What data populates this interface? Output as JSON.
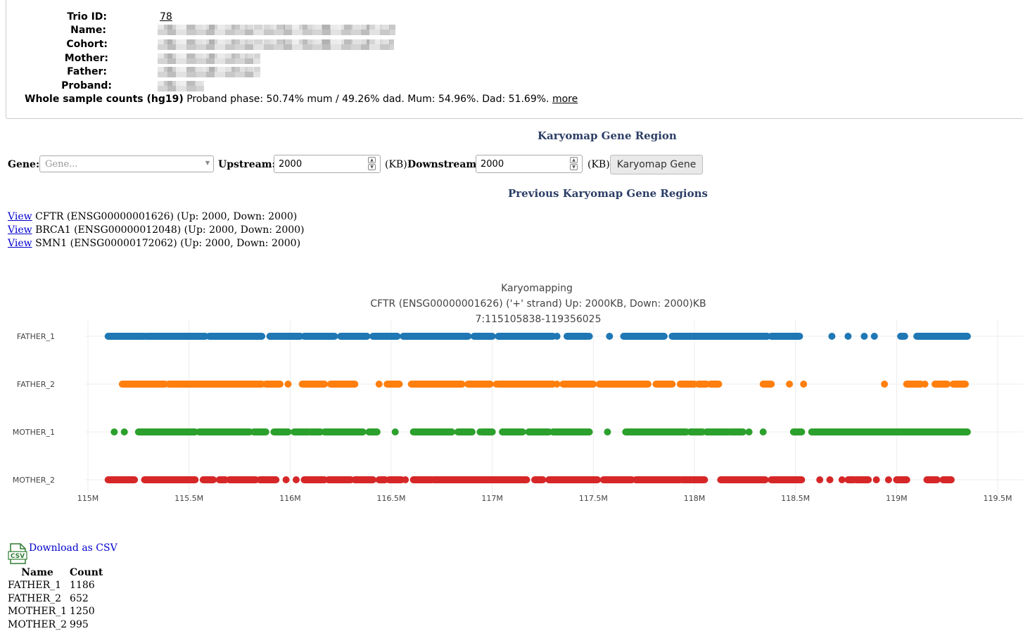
{
  "trio": {
    "labels": {
      "trio_id": "Trio ID:",
      "name": "Name:",
      "cohort": "Cohort:",
      "mother": "Mother:",
      "father": "Father:",
      "proband": "Proband:"
    },
    "trio_id_value": "78",
    "whole_sample_label": "Whole sample counts (hg19)",
    "whole_sample_text": "Proband phase: 50.74% mum / 49.26% dad. Mum: 54.96%. Dad: 51.69%.",
    "more_link": "more"
  },
  "gene_region": {
    "heading": "Karyomap Gene Region",
    "gene_label": "Gene:",
    "gene_placeholder": "Gene...",
    "upstream_label": "Upstream:",
    "upstream_value": "2000",
    "downstream_label": "Downstream:",
    "downstream_value": "2000",
    "unit": "(KB)",
    "button_label": "Karyomap Gene"
  },
  "previous": {
    "heading": "Previous Karyomap Gene Regions",
    "items": [
      {
        "link": "View",
        "text": "CFTR (ENSG00000001626) (Up: 2000, Down: 2000)"
      },
      {
        "link": "View",
        "text": "BRCA1 (ENSG00000012048) (Up: 2000, Down: 2000)"
      },
      {
        "link": "View",
        "text": "SMN1 (ENSG00000172062) (Up: 2000, Down: 2000)"
      }
    ]
  },
  "chart_data": {
    "type": "scatter",
    "title": "Karyomapping",
    "subtitle": "CFTR (ENSG00000001626) ('+' strand) Up: 2000KB, Down: 2000)KB",
    "region": "7:115105838-119356025",
    "xlim": [
      115000000,
      119500000
    ],
    "x_ticks": [
      {
        "value": 115000000,
        "label": "115M"
      },
      {
        "value": 115500000,
        "label": "115.5M"
      },
      {
        "value": 116000000,
        "label": "116M"
      },
      {
        "value": 116500000,
        "label": "116.5M"
      },
      {
        "value": 117000000,
        "label": "117M"
      },
      {
        "value": 117500000,
        "label": "117.5M"
      },
      {
        "value": 118000000,
        "label": "118M"
      },
      {
        "value": 118500000,
        "label": "118.5M"
      },
      {
        "value": 119000000,
        "label": "119M"
      },
      {
        "value": 119500000,
        "label": "119.5M"
      }
    ],
    "grid": true,
    "series": [
      {
        "name": "FATHER_1",
        "color": "#1f77b4",
        "segments": [
          [
            115.1,
            115.28
          ],
          [
            115.29,
            115.58
          ],
          [
            115.6,
            115.86
          ],
          [
            115.9,
            116.05
          ],
          [
            116.07,
            116.22
          ],
          [
            116.25,
            116.38
          ],
          [
            116.41,
            116.53
          ],
          [
            116.56,
            116.88
          ],
          [
            116.91,
            117.0
          ],
          [
            117.03,
            117.3
          ],
          [
            117.37,
            117.47
          ],
          [
            117.65,
            117.85
          ],
          [
            117.89,
            118.36
          ],
          [
            118.38,
            118.52
          ],
          [
            119.02,
            119.04
          ],
          [
            119.1,
            119.35
          ]
        ],
        "points": [
          117.32,
          117.48,
          117.58,
          118.68,
          118.76,
          118.84,
          118.89
        ]
      },
      {
        "name": "FATHER_2",
        "color": "#ff7f0e",
        "segments": [
          [
            115.17,
            115.38
          ],
          [
            115.4,
            115.86
          ],
          [
            115.88,
            115.95
          ],
          [
            116.06,
            116.17
          ],
          [
            116.2,
            116.32
          ],
          [
            116.48,
            116.54
          ],
          [
            116.6,
            116.85
          ],
          [
            116.88,
            116.99
          ],
          [
            117.03,
            117.3
          ],
          [
            117.35,
            117.5
          ],
          [
            117.53,
            117.77
          ],
          [
            117.81,
            117.89
          ],
          [
            117.93,
            118.0
          ],
          [
            118.02,
            118.06
          ],
          [
            118.08,
            118.12
          ],
          [
            118.34,
            118.38
          ],
          [
            119.05,
            119.12
          ],
          [
            119.19,
            119.25
          ],
          [
            119.28,
            119.34
          ]
        ],
        "points": [
          115.99,
          116.44,
          117.02,
          117.32,
          118.47,
          118.54,
          118.94,
          119.14
        ]
      },
      {
        "name": "MOTHER_1",
        "color": "#2ca02c",
        "segments": [
          [
            115.25,
            115.53
          ],
          [
            115.55,
            115.8
          ],
          [
            115.82,
            115.88
          ],
          [
            115.92,
            115.99
          ],
          [
            116.02,
            116.09
          ],
          [
            116.1,
            116.15
          ],
          [
            116.17,
            116.36
          ],
          [
            116.39,
            116.43
          ],
          [
            116.61,
            116.8
          ],
          [
            116.83,
            116.9
          ],
          [
            116.95,
            117.0
          ],
          [
            117.05,
            117.15
          ],
          [
            117.18,
            117.28
          ],
          [
            117.3,
            117.48
          ],
          [
            117.66,
            117.96
          ],
          [
            117.98,
            118.04
          ],
          [
            118.06,
            118.17
          ],
          [
            118.18,
            118.24
          ],
          [
            118.49,
            118.53
          ],
          [
            118.58,
            119.35
          ]
        ],
        "points": [
          115.13,
          115.18,
          116.52,
          116.94,
          117.57,
          118.27,
          118.34
        ]
      },
      {
        "name": "MOTHER_2",
        "color": "#d62728",
        "segments": [
          [
            115.1,
            115.23
          ],
          [
            115.28,
            115.53
          ],
          [
            115.57,
            115.62
          ],
          [
            115.65,
            115.68
          ],
          [
            115.7,
            115.83
          ],
          [
            115.85,
            115.93
          ],
          [
            116.07,
            116.17
          ],
          [
            116.19,
            116.3
          ],
          [
            116.32,
            116.41
          ],
          [
            116.44,
            116.47
          ],
          [
            116.49,
            116.55
          ],
          [
            116.61,
            116.7
          ],
          [
            116.71,
            117.17
          ],
          [
            117.21,
            117.25
          ],
          [
            117.28,
            117.52
          ],
          [
            117.55,
            117.69
          ],
          [
            117.71,
            117.93
          ],
          [
            117.94,
            118.05
          ],
          [
            118.13,
            118.35
          ],
          [
            118.38,
            118.53
          ],
          [
            118.76,
            118.79
          ],
          [
            118.8,
            118.86
          ],
          [
            119.0,
            119.05
          ],
          [
            119.15,
            119.2
          ],
          [
            119.23,
            119.27
          ]
        ],
        "points": [
          115.98,
          116.03,
          116.57,
          118.62,
          118.67,
          118.73,
          118.9,
          118.96
        ]
      }
    ]
  },
  "download": {
    "icon_text": "CSV",
    "link": "Download as CSV"
  },
  "counts": {
    "headers": [
      "Name",
      "Count"
    ],
    "rows": [
      {
        "name": "FATHER_1",
        "count": "1186"
      },
      {
        "name": "FATHER_2",
        "count": "652"
      },
      {
        "name": "MOTHER_1",
        "count": "1250"
      },
      {
        "name": "MOTHER_2",
        "count": "995"
      }
    ]
  }
}
